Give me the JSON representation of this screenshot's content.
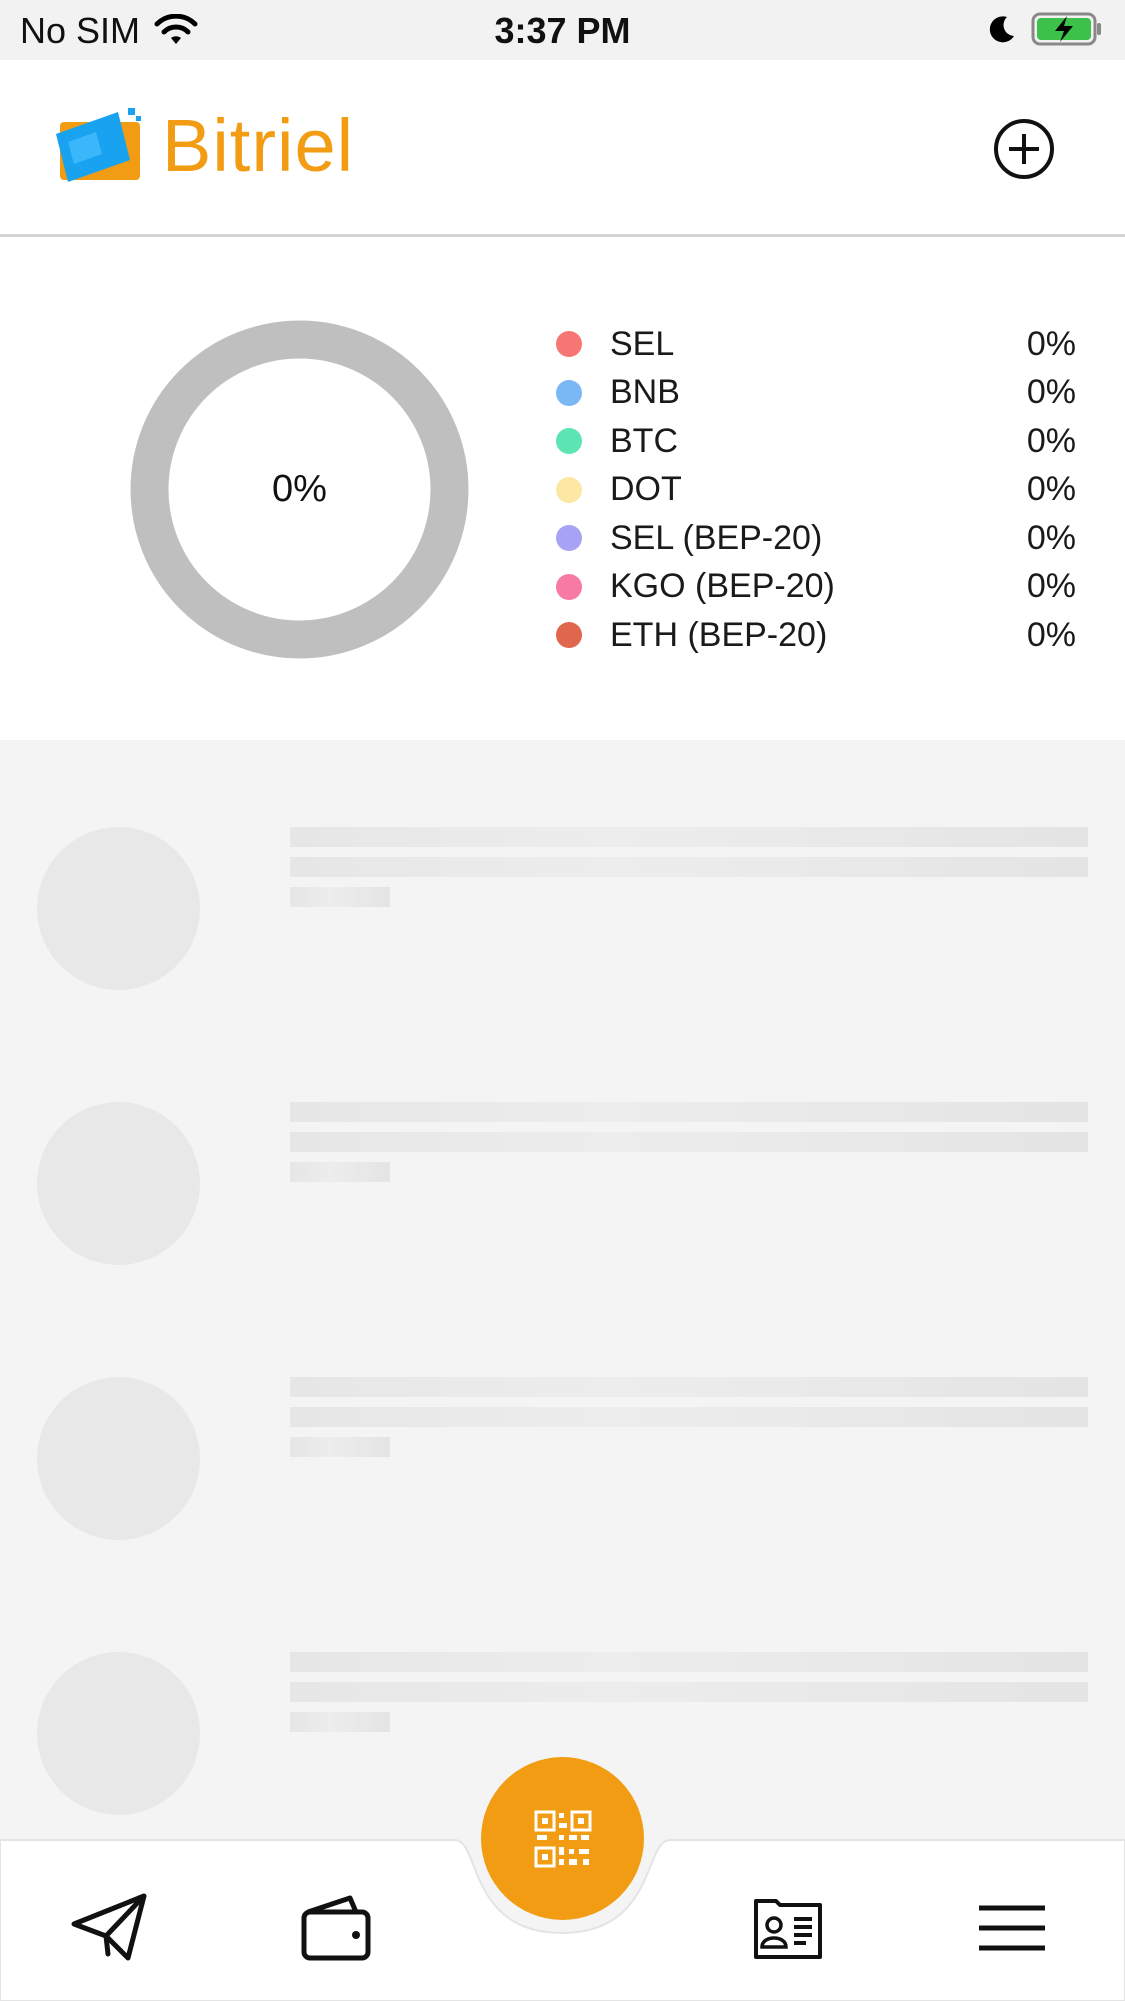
{
  "status_bar": {
    "carrier": "No SIM",
    "time": "3:37 PM"
  },
  "header": {
    "app_name": "Bitriel",
    "brand_color": "#f29c14"
  },
  "portfolio": {
    "total_percent": "0%",
    "legend": [
      {
        "name": "SEL",
        "percent": "0%",
        "color": "#f77673"
      },
      {
        "name": "BNB",
        "percent": "0%",
        "color": "#7ab8f5"
      },
      {
        "name": "BTC",
        "percent": "0%",
        "color": "#5de4b3"
      },
      {
        "name": "DOT",
        "percent": "0%",
        "color": "#fde7a4"
      },
      {
        "name": "SEL (BEP-20)",
        "percent": "0%",
        "color": "#a8a2f5"
      },
      {
        "name": "KGO (BEP-20)",
        "percent": "0%",
        "color": "#f67aa3"
      },
      {
        "name": "ETH (BEP-20)",
        "percent": "0%",
        "color": "#e0664e"
      }
    ]
  },
  "bottom_nav": {
    "items": [
      "send-icon",
      "wallet-icon",
      "qr-code-icon",
      "contact-card-icon",
      "menu-icon"
    ]
  }
}
